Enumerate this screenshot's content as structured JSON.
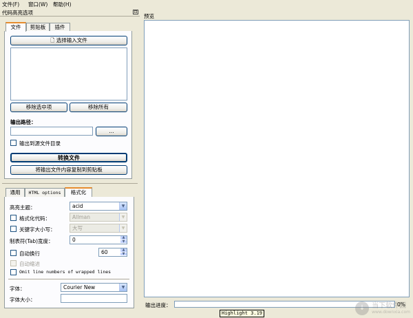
{
  "menu": {
    "file": "文件(F)",
    "window": "窗口(W)",
    "help": "帮助(H)"
  },
  "panel": {
    "title": "代码高亮选项",
    "dock_glyph": "⊡"
  },
  "top_tabs": [
    "文件",
    "剪贴板",
    "插件"
  ],
  "file_tab": {
    "select_input": "选择输入文件",
    "remove_selected": "移除选中项",
    "remove_all": "移除所有",
    "output_path_label": "输出路径：",
    "output_path_value": "",
    "browse": "...",
    "output_to_source": "输出到源文件目录",
    "convert": "转换文件",
    "copy_to_clipboard": "将输出文件内容复制到剪贴板"
  },
  "bottom_tabs": [
    "通用",
    "HTML options",
    "格式化"
  ],
  "format_tab": {
    "theme_label": "高亮主题：",
    "theme_value": "acid",
    "format_code_label": "格式化代码：",
    "format_code_value": "Allman",
    "keyword_case_label": "关键字大小写：",
    "keyword_case_value": "大写",
    "tab_width_label": "制表符(Tab)宽度：",
    "tab_width_value": "0",
    "auto_wrap_label": "自动换行",
    "auto_wrap_value": "60",
    "auto_indent_label": "自动缩进",
    "omit_line_numbers_label": "Omit line numbers of wrapped lines",
    "font_label": "字体：",
    "font_value": "Courier New",
    "font_size_label": "字体大小：",
    "font_size_value": ""
  },
  "preview": {
    "label": "预览"
  },
  "progress": {
    "label": "输出进度：",
    "value": 0,
    "text": "0%"
  },
  "tooltip": "Highlight 3.19",
  "watermark": {
    "logo": "↓",
    "text": "当下软件园",
    "sub": "www.downxia.com"
  }
}
